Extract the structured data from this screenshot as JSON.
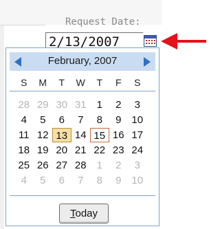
{
  "field": {
    "label": "Request Date:",
    "value": "2/13/2007"
  },
  "calendar": {
    "month_title": "February, 2007",
    "weekdays": [
      "S",
      "M",
      "T",
      "W",
      "T",
      "F",
      "S"
    ],
    "weeks": [
      [
        {
          "d": "28",
          "o": true
        },
        {
          "d": "29",
          "o": true
        },
        {
          "d": "30",
          "o": true
        },
        {
          "d": "31",
          "o": true
        },
        {
          "d": "1"
        },
        {
          "d": "2"
        },
        {
          "d": "3"
        }
      ],
      [
        {
          "d": "4"
        },
        {
          "d": "5"
        },
        {
          "d": "6"
        },
        {
          "d": "7"
        },
        {
          "d": "8"
        },
        {
          "d": "9"
        },
        {
          "d": "10"
        }
      ],
      [
        {
          "d": "11"
        },
        {
          "d": "12"
        },
        {
          "d": "13",
          "today": true
        },
        {
          "d": "14"
        },
        {
          "d": "15",
          "sel": true
        },
        {
          "d": "16"
        },
        {
          "d": "17"
        }
      ],
      [
        {
          "d": "18"
        },
        {
          "d": "19"
        },
        {
          "d": "20"
        },
        {
          "d": "21"
        },
        {
          "d": "22"
        },
        {
          "d": "23"
        },
        {
          "d": "24"
        }
      ],
      [
        {
          "d": "25"
        },
        {
          "d": "26"
        },
        {
          "d": "27"
        },
        {
          "d": "28"
        },
        {
          "d": "1",
          "o": true
        },
        {
          "d": "2",
          "o": true
        },
        {
          "d": "3",
          "o": true
        }
      ],
      [
        {
          "d": "4",
          "o": true
        },
        {
          "d": "5",
          "o": true
        },
        {
          "d": "6",
          "o": true
        },
        {
          "d": "7",
          "o": true
        },
        {
          "d": "8",
          "o": true
        },
        {
          "d": "9",
          "o": true
        },
        {
          "d": "10",
          "o": true
        }
      ]
    ],
    "today_button": "Today"
  },
  "icons": {
    "calendar_button": "calendar-icon",
    "prev": "triangle-left-icon",
    "next": "triangle-right-icon",
    "pointer": "red-arrow-icon"
  },
  "colors": {
    "header_bg": "#c9dcf2",
    "nav_arrow": "#2f6fc4",
    "border": "#7ea2c6",
    "today_fill": "#f6dfa6",
    "selected_border": "#c5693d",
    "arrow_red": "#e3121b"
  }
}
